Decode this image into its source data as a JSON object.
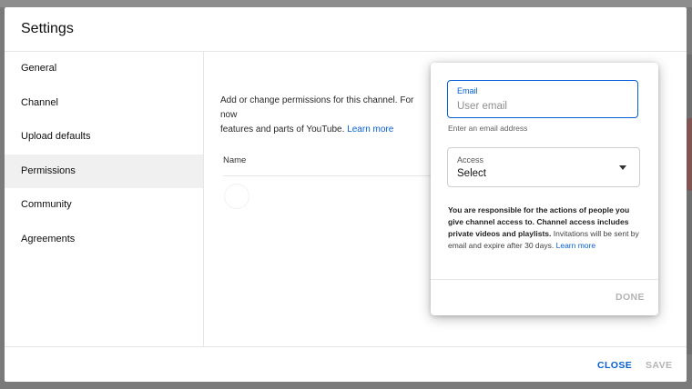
{
  "dialog": {
    "title": "Settings"
  },
  "nav": {
    "items": [
      {
        "label": "General"
      },
      {
        "label": "Channel"
      },
      {
        "label": "Upload defaults"
      },
      {
        "label": "Permissions",
        "active": true
      },
      {
        "label": "Community"
      },
      {
        "label": "Agreements"
      }
    ]
  },
  "permissions": {
    "description_line1": "Add or change permissions for this channel. For now",
    "description_line2": "features and parts of YouTube.",
    "learn_more": "Learn more",
    "column_name": "Name"
  },
  "invite": {
    "email_label": "Email",
    "email_placeholder": "User email",
    "email_value": "",
    "email_help": "Enter an email address",
    "access_label": "Access",
    "access_value": "Select",
    "note_bold": "You are responsible for the actions of people you give channel access to. Channel access includes private videos and playlists.",
    "note_text": " Invitations will be sent by email and expire after 30 days.",
    "note_link": "Learn more",
    "done_label": "DONE"
  },
  "footer": {
    "close_label": "CLOSE",
    "save_label": "SAVE"
  },
  "colors": {
    "accent": "#065fd4",
    "disabled": "#b3b3b3",
    "overlay": "#7a7a7a"
  }
}
